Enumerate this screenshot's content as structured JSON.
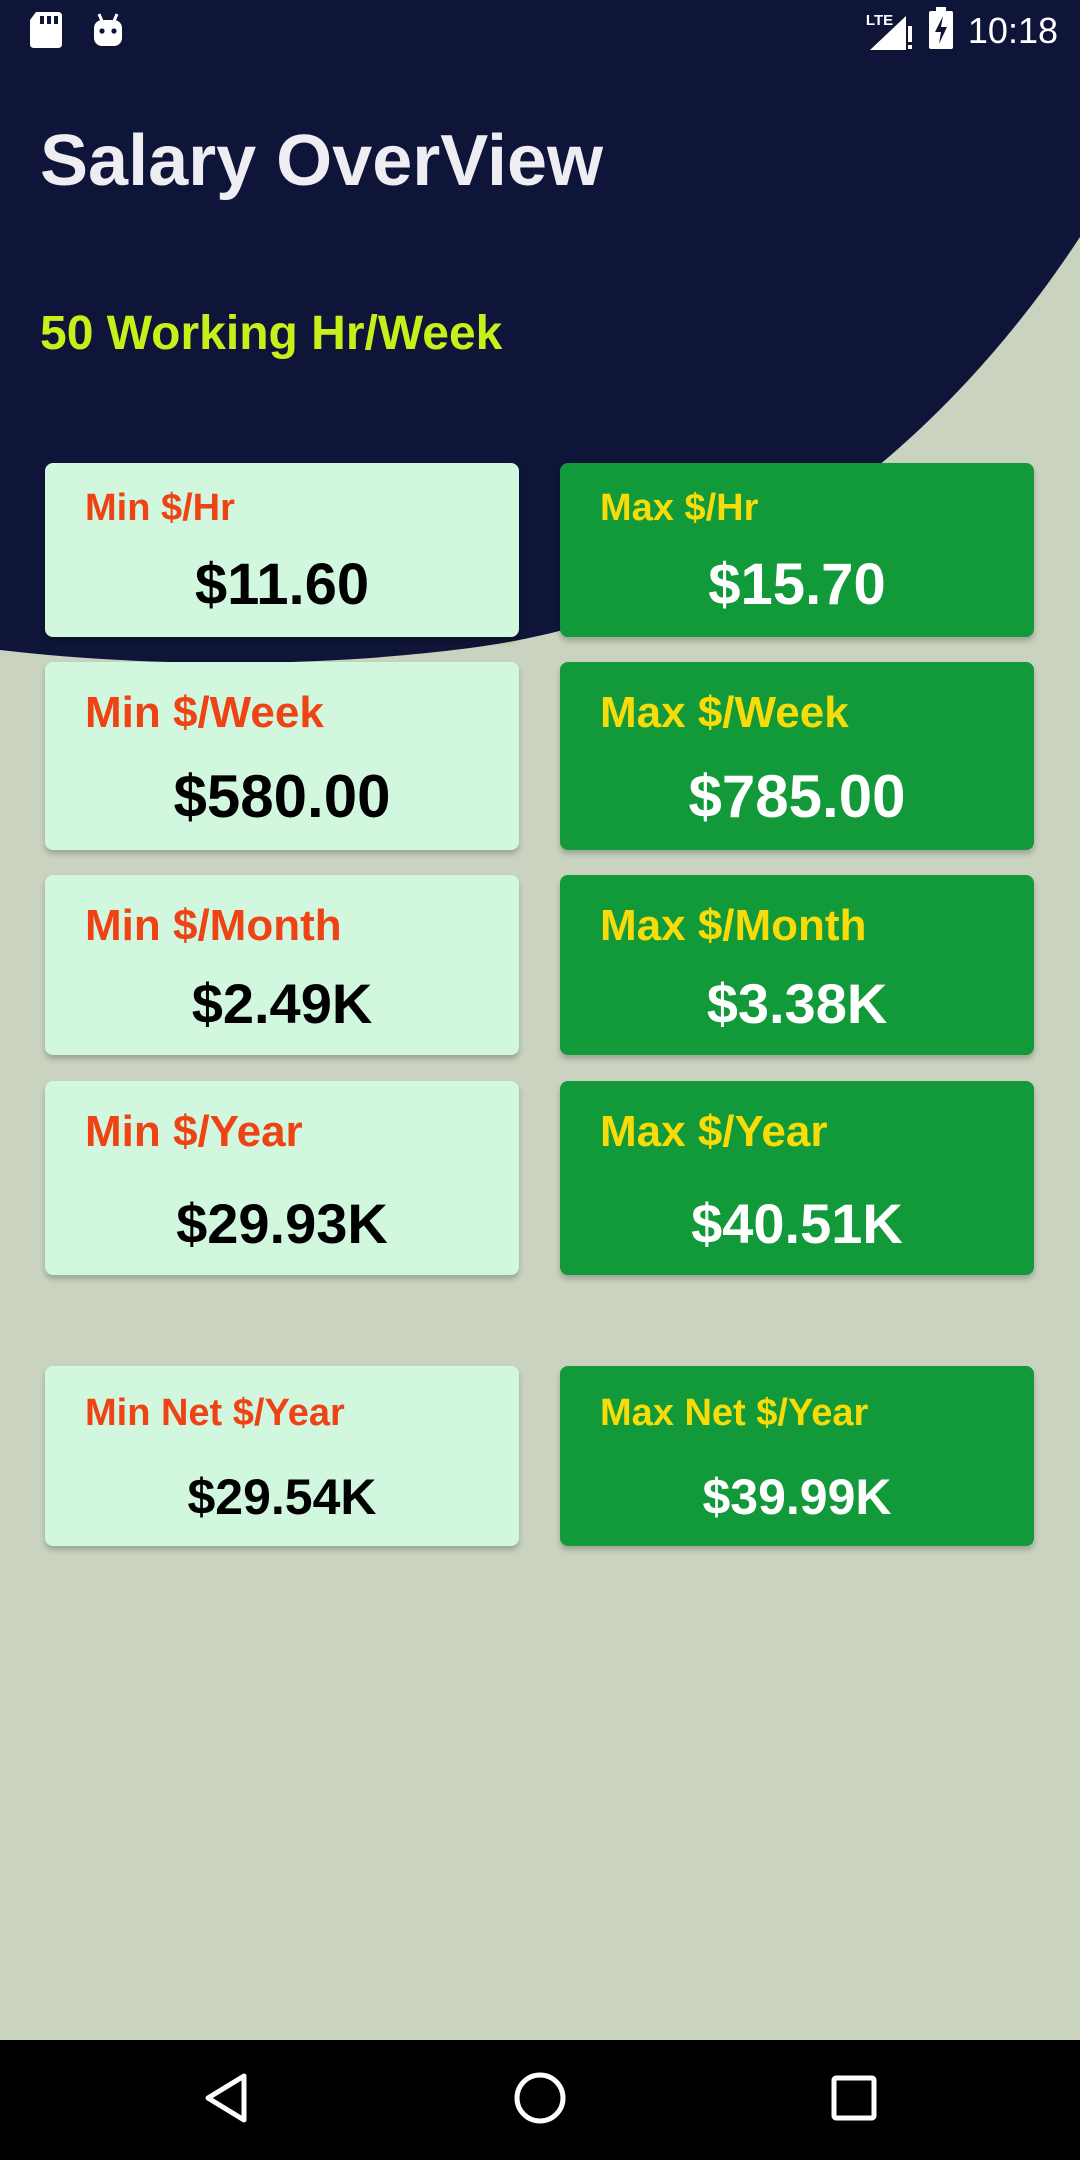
{
  "status_bar": {
    "time": "10:18",
    "network_label": "LTE",
    "left_icons": [
      "sd-card-icon",
      "android-icon"
    ],
    "right_icons": [
      "lte-signal-icon",
      "battery-charging-icon"
    ]
  },
  "header": {
    "title": "Salary OverView",
    "subtitle": "50 Working Hr/Week"
  },
  "cards": {
    "hr": {
      "min": {
        "label": "Min $/Hr",
        "value": "$11.60"
      },
      "max": {
        "label": "Max $/Hr",
        "value": "$15.70"
      }
    },
    "week": {
      "min": {
        "label": "Min $/Week",
        "value": "$580.00"
      },
      "max": {
        "label": "Max $/Week",
        "value": "$785.00"
      }
    },
    "month": {
      "min": {
        "label": "Min $/Month",
        "value": "$2.49K"
      },
      "max": {
        "label": "Max $/Month",
        "value": "$3.38K"
      }
    },
    "year": {
      "min": {
        "label": "Min $/Year",
        "value": "$29.93K"
      },
      "max": {
        "label": "Max $/Year",
        "value": "$40.51K"
      }
    },
    "net_year": {
      "min": {
        "label": "Min Net $/Year",
        "value": "$29.54K"
      },
      "max": {
        "label": "Max Net $/Year",
        "value": "$39.99K"
      }
    }
  },
  "nav_bar": {
    "buttons": [
      "back-icon",
      "home-icon",
      "recents-icon"
    ]
  },
  "colors": {
    "header_background": "#0f1538",
    "page_background": "#c9d3bf",
    "min_card_background": "#d1f7de",
    "max_card_background": "#11993a",
    "min_label": "#ed4315",
    "max_label": "#f7dc09",
    "subtitle": "#c9ef1a"
  }
}
